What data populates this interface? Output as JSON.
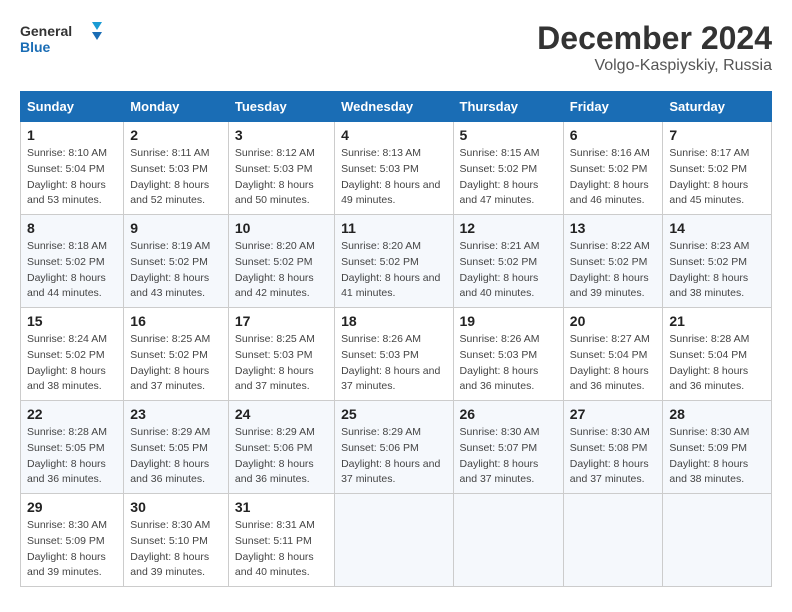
{
  "logo": {
    "line1": "General",
    "line2": "Blue"
  },
  "title": "December 2024",
  "location": "Volgo-Kaspiyskiy, Russia",
  "days_of_week": [
    "Sunday",
    "Monday",
    "Tuesday",
    "Wednesday",
    "Thursday",
    "Friday",
    "Saturday"
  ],
  "weeks": [
    [
      {
        "day": 1,
        "sunrise": "8:10 AM",
        "sunset": "5:04 PM",
        "daylight": "8 hours and 53 minutes."
      },
      {
        "day": 2,
        "sunrise": "8:11 AM",
        "sunset": "5:03 PM",
        "daylight": "8 hours and 52 minutes."
      },
      {
        "day": 3,
        "sunrise": "8:12 AM",
        "sunset": "5:03 PM",
        "daylight": "8 hours and 50 minutes."
      },
      {
        "day": 4,
        "sunrise": "8:13 AM",
        "sunset": "5:03 PM",
        "daylight": "8 hours and 49 minutes."
      },
      {
        "day": 5,
        "sunrise": "8:15 AM",
        "sunset": "5:02 PM",
        "daylight": "8 hours and 47 minutes."
      },
      {
        "day": 6,
        "sunrise": "8:16 AM",
        "sunset": "5:02 PM",
        "daylight": "8 hours and 46 minutes."
      },
      {
        "day": 7,
        "sunrise": "8:17 AM",
        "sunset": "5:02 PM",
        "daylight": "8 hours and 45 minutes."
      }
    ],
    [
      {
        "day": 8,
        "sunrise": "8:18 AM",
        "sunset": "5:02 PM",
        "daylight": "8 hours and 44 minutes."
      },
      {
        "day": 9,
        "sunrise": "8:19 AM",
        "sunset": "5:02 PM",
        "daylight": "8 hours and 43 minutes."
      },
      {
        "day": 10,
        "sunrise": "8:20 AM",
        "sunset": "5:02 PM",
        "daylight": "8 hours and 42 minutes."
      },
      {
        "day": 11,
        "sunrise": "8:20 AM",
        "sunset": "5:02 PM",
        "daylight": "8 hours and 41 minutes."
      },
      {
        "day": 12,
        "sunrise": "8:21 AM",
        "sunset": "5:02 PM",
        "daylight": "8 hours and 40 minutes."
      },
      {
        "day": 13,
        "sunrise": "8:22 AM",
        "sunset": "5:02 PM",
        "daylight": "8 hours and 39 minutes."
      },
      {
        "day": 14,
        "sunrise": "8:23 AM",
        "sunset": "5:02 PM",
        "daylight": "8 hours and 38 minutes."
      }
    ],
    [
      {
        "day": 15,
        "sunrise": "8:24 AM",
        "sunset": "5:02 PM",
        "daylight": "8 hours and 38 minutes."
      },
      {
        "day": 16,
        "sunrise": "8:25 AM",
        "sunset": "5:02 PM",
        "daylight": "8 hours and 37 minutes."
      },
      {
        "day": 17,
        "sunrise": "8:25 AM",
        "sunset": "5:03 PM",
        "daylight": "8 hours and 37 minutes."
      },
      {
        "day": 18,
        "sunrise": "8:26 AM",
        "sunset": "5:03 PM",
        "daylight": "8 hours and 37 minutes."
      },
      {
        "day": 19,
        "sunrise": "8:26 AM",
        "sunset": "5:03 PM",
        "daylight": "8 hours and 36 minutes."
      },
      {
        "day": 20,
        "sunrise": "8:27 AM",
        "sunset": "5:04 PM",
        "daylight": "8 hours and 36 minutes."
      },
      {
        "day": 21,
        "sunrise": "8:28 AM",
        "sunset": "5:04 PM",
        "daylight": "8 hours and 36 minutes."
      }
    ],
    [
      {
        "day": 22,
        "sunrise": "8:28 AM",
        "sunset": "5:05 PM",
        "daylight": "8 hours and 36 minutes."
      },
      {
        "day": 23,
        "sunrise": "8:29 AM",
        "sunset": "5:05 PM",
        "daylight": "8 hours and 36 minutes."
      },
      {
        "day": 24,
        "sunrise": "8:29 AM",
        "sunset": "5:06 PM",
        "daylight": "8 hours and 36 minutes."
      },
      {
        "day": 25,
        "sunrise": "8:29 AM",
        "sunset": "5:06 PM",
        "daylight": "8 hours and 37 minutes."
      },
      {
        "day": 26,
        "sunrise": "8:30 AM",
        "sunset": "5:07 PM",
        "daylight": "8 hours and 37 minutes."
      },
      {
        "day": 27,
        "sunrise": "8:30 AM",
        "sunset": "5:08 PM",
        "daylight": "8 hours and 37 minutes."
      },
      {
        "day": 28,
        "sunrise": "8:30 AM",
        "sunset": "5:09 PM",
        "daylight": "8 hours and 38 minutes."
      }
    ],
    [
      {
        "day": 29,
        "sunrise": "8:30 AM",
        "sunset": "5:09 PM",
        "daylight": "8 hours and 39 minutes."
      },
      {
        "day": 30,
        "sunrise": "8:30 AM",
        "sunset": "5:10 PM",
        "daylight": "8 hours and 39 minutes."
      },
      {
        "day": 31,
        "sunrise": "8:31 AM",
        "sunset": "5:11 PM",
        "daylight": "8 hours and 40 minutes."
      },
      null,
      null,
      null,
      null
    ]
  ],
  "labels": {
    "sunrise": "Sunrise:",
    "sunset": "Sunset:",
    "daylight": "Daylight:"
  }
}
